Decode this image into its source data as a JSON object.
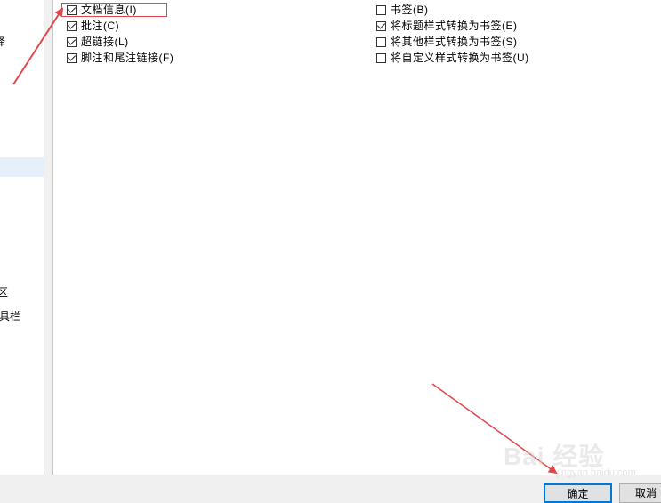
{
  "sidebar": {
    "items": [
      {
        "label": "译",
        "selected": false
      },
      {
        "label": "",
        "selected": true
      },
      {
        "label": "区",
        "selected": false
      },
      {
        "label": "具栏",
        "selected": false
      }
    ]
  },
  "options": {
    "left": [
      {
        "label": "文档信息(I)",
        "checked": true
      },
      {
        "label": "批注(C)",
        "checked": true
      },
      {
        "label": "超链接(L)",
        "checked": true
      },
      {
        "label": "脚注和尾注链接(F)",
        "checked": true
      }
    ],
    "right": [
      {
        "label": "书签(B)",
        "checked": false
      },
      {
        "label": "将标题样式转换为书签(E)",
        "checked": true
      },
      {
        "label": "将其他样式转换为书签(S)",
        "checked": false
      },
      {
        "label": "将自定义样式转换为书签(U)",
        "checked": false
      }
    ]
  },
  "buttons": {
    "ok": "确定",
    "cancel": "取消"
  },
  "watermark": {
    "text": "Bai 经验",
    "sub": "jingyan.baidu.com"
  },
  "colors": {
    "annotation": "#e0474c",
    "selection": "#e5f0fb",
    "primary_border": "#0078d7"
  }
}
